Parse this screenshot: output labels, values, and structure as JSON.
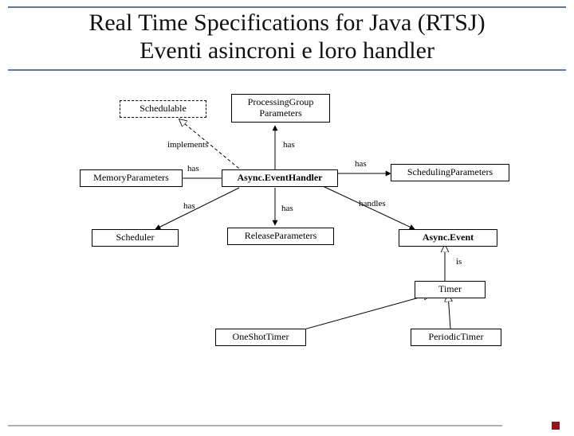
{
  "title": {
    "line1": "Real Time Specifications for Java (RTSJ)",
    "line2": "Eventi asincroni e loro handler"
  },
  "boxes": {
    "schedulable": "Schedulable",
    "processing_group": "ProcessingGroup\nParameters",
    "memory_params": "MemoryParameters",
    "async_handler": "Async.EventHandler",
    "scheduling_params": "SchedulingParameters",
    "scheduler": "Scheduler",
    "release_params": "ReleaseParameters",
    "async_event": "Async.Event",
    "timer": "Timer",
    "one_shot_timer": "OneShotTimer",
    "periodic_timer": "PeriodicTimer"
  },
  "edge_labels": {
    "implements": "implements",
    "has1": "has",
    "has2": "has",
    "has3": "has",
    "has4": "has",
    "has5": "has",
    "handles": "handles",
    "is": "is"
  }
}
